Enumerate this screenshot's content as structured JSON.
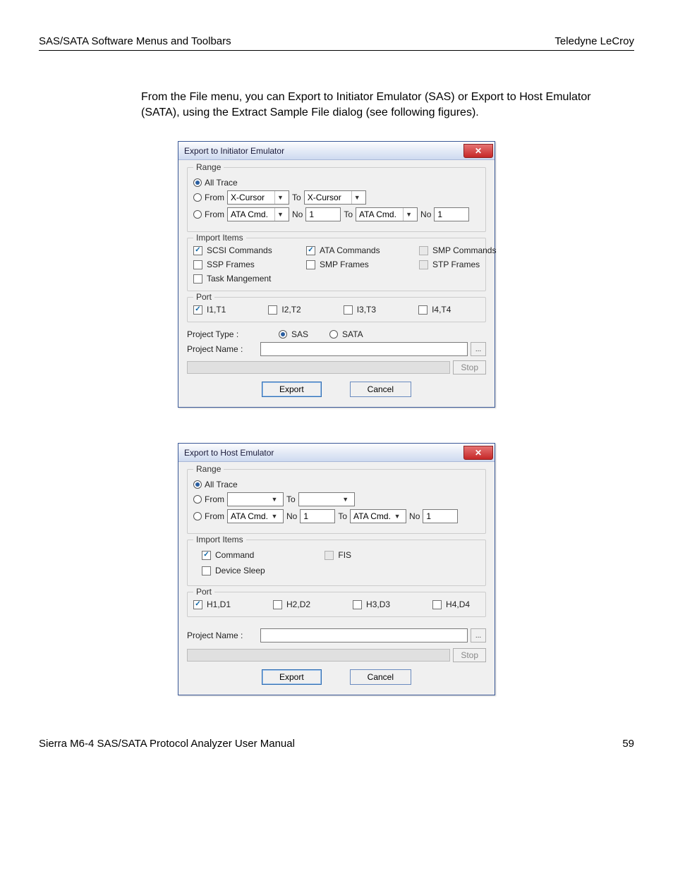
{
  "header": {
    "left": "SAS/SATA Software Menus and Toolbars",
    "right": "Teledyne LeCroy"
  },
  "intro": "From the File menu, you can Export to Initiator Emulator (SAS) or Export to Host Emulator (SATA), using the Extract Sample File dialog (see following figures).",
  "footer": {
    "left": "Sierra M6-4 SAS/SATA Protocol Analyzer User Manual",
    "right": "59"
  },
  "dlg1": {
    "title": "Export to Initiator Emulator",
    "range": {
      "legend": "Range",
      "allTrace": "All Trace",
      "fromLbl": "From",
      "toLbl": "To",
      "xcursor": "X-Cursor",
      "atacmd": "ATA Cmd.",
      "noLbl": "No",
      "noVal": "1"
    },
    "import": {
      "legend": "Import Items",
      "scsi": "SCSI Commands",
      "ata": "ATA Commands",
      "smpc": "SMP Commands",
      "ssp": "SSP Frames",
      "smpf": "SMP Frames",
      "stp": "STP Frames",
      "task": "Task Mangement"
    },
    "port": {
      "legend": "Port",
      "p1": "I1,T1",
      "p2": "I2,T2",
      "p3": "I3,T3",
      "p4": "I4,T4"
    },
    "ptypeLbl": "Project Type :",
    "ptypeSAS": "SAS",
    "ptypeSATA": "SATA",
    "pnameLbl": "Project Name :",
    "stop": "Stop",
    "export": "Export",
    "cancel": "Cancel"
  },
  "dlg2": {
    "title": "Export to Host Emulator",
    "range": {
      "legend": "Range",
      "allTrace": "All Trace",
      "fromLbl": "From",
      "toLbl": "To",
      "atacmd": "ATA Cmd.",
      "noLbl": "No",
      "noVal": "1"
    },
    "import": {
      "legend": "Import Items",
      "cmd": "Command",
      "fis": "FIS",
      "dsleep": "Device Sleep"
    },
    "port": {
      "legend": "Port",
      "p1": "H1,D1",
      "p2": "H2,D2",
      "p3": "H3,D3",
      "p4": "H4,D4"
    },
    "pnameLbl": "Project Name :",
    "stop": "Stop",
    "export": "Export",
    "cancel": "Cancel"
  }
}
